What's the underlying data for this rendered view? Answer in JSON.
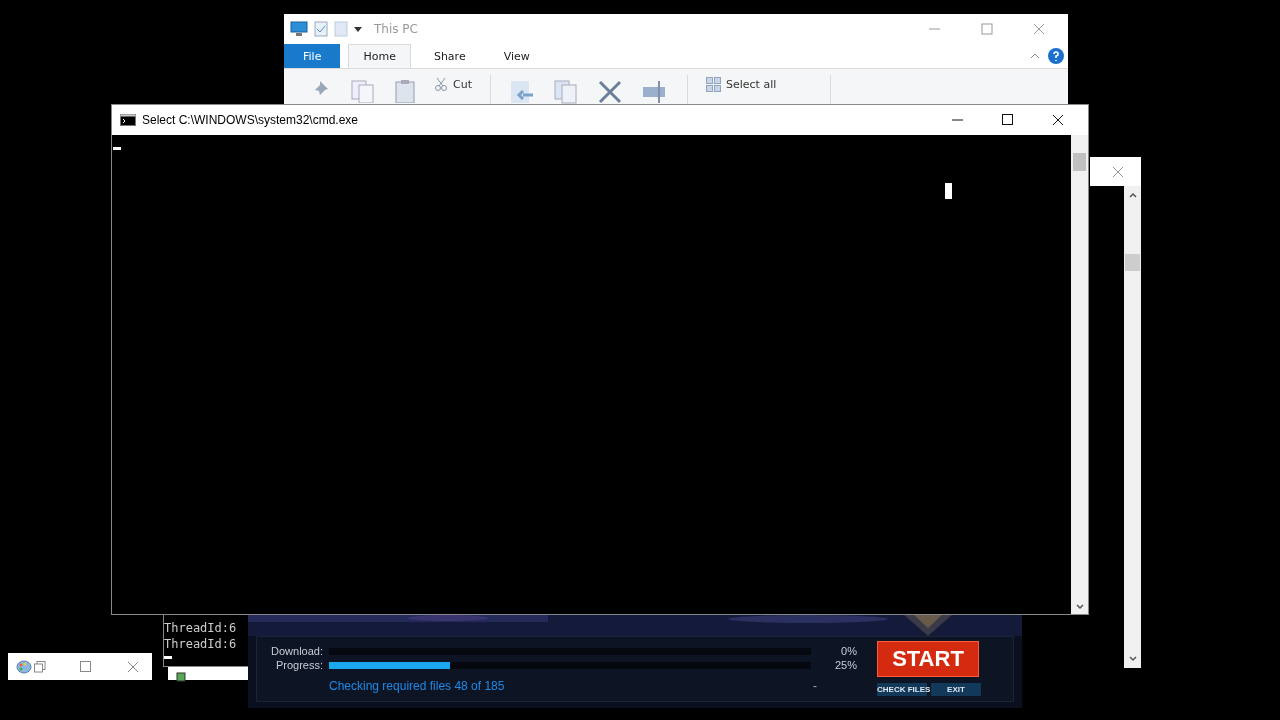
{
  "explorer": {
    "title": "This PC",
    "tabs": [
      {
        "label": "File",
        "kind": "file",
        "selected": false
      },
      {
        "label": "Home",
        "kind": "tab",
        "selected": true
      },
      {
        "label": "Share",
        "kind": "tab",
        "selected": false
      },
      {
        "label": "View",
        "kind": "tab",
        "selected": false
      }
    ],
    "commands": [
      "Cut",
      "Select all"
    ]
  },
  "console": {
    "title": "Select C:\\WINDOWS\\system32\\cmd.exe"
  },
  "background_console": {
    "lines": [
      "ThreadId:6",
      "ThreadId:6"
    ]
  },
  "launcher": {
    "rows": [
      {
        "label": "Download:",
        "reading": "0%"
      },
      {
        "label": "Progress:",
        "level": 0.25,
        "reading": "25%"
      }
    ],
    "status": "Checking required files 48 of 185",
    "dash": "-",
    "start": "START",
    "buttons": [
      "CHECK FILES",
      "EXIT"
    ]
  }
}
